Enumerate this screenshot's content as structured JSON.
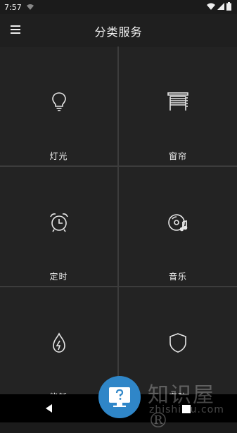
{
  "status_bar": {
    "time": "7:57"
  },
  "app_bar": {
    "title": "分类服务"
  },
  "tiles": [
    {
      "label": "灯光",
      "icon": "bulb-icon"
    },
    {
      "label": "窗帘",
      "icon": "curtain-icon"
    },
    {
      "label": "定时",
      "icon": "alarm-clock-icon"
    },
    {
      "label": "音乐",
      "icon": "music-disc-icon"
    },
    {
      "label": "能耗",
      "icon": "energy-flame-icon"
    },
    {
      "label": "安防",
      "icon": "shield-icon"
    }
  ],
  "watermark": {
    "text": "知识屋®",
    "url": "zhishiwu.com"
  },
  "colors": {
    "background": "#1b1b1b",
    "tile": "#232323",
    "divider": "#3c3c3c",
    "watermark_blue": "#2f86c8"
  }
}
